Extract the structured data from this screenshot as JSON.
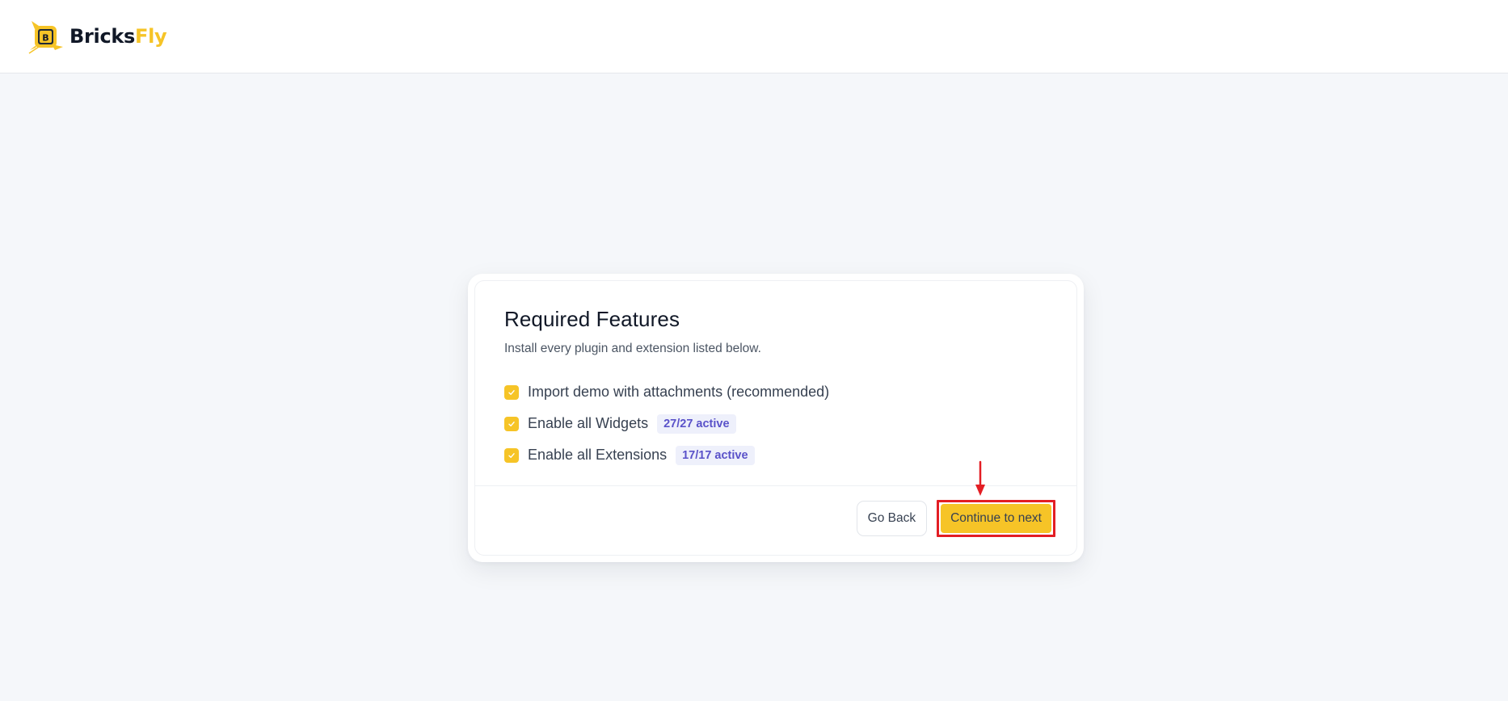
{
  "brand": {
    "name_part1": "Bricks",
    "name_part2": "Fly",
    "mark_letter": "B",
    "colors": {
      "accent": "#f6c427",
      "dark": "#111827"
    }
  },
  "card": {
    "title": "Required Features",
    "subtitle": "Install every plugin and extension listed below.",
    "options": [
      {
        "label": "Import demo with attachments (recommended)",
        "checked": true,
        "badge": null
      },
      {
        "label": "Enable all Widgets",
        "checked": true,
        "badge": "27/27 active"
      },
      {
        "label": "Enable all Extensions",
        "checked": true,
        "badge": "17/17 active"
      }
    ],
    "footer": {
      "back_label": "Go Back",
      "next_label": "Continue to next"
    }
  },
  "annotation": {
    "highlight_color": "#e31e24",
    "arrow_icon": "arrow-down-icon"
  },
  "colors": {
    "page_bg": "#f5f7fa",
    "checkbox": "#f6c427",
    "badge_bg": "#eef0fb",
    "badge_text": "#5a52c9",
    "primary_button": "#f6c427"
  }
}
